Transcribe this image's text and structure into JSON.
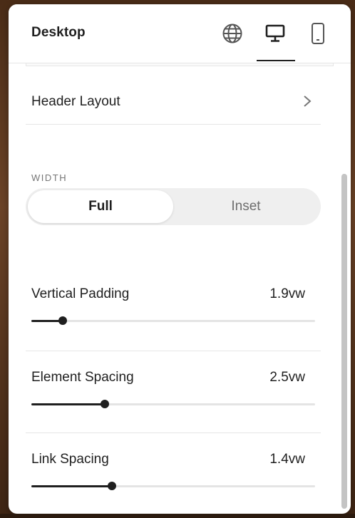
{
  "header": {
    "title": "Desktop",
    "icons": [
      "globe-icon",
      "desktop-icon",
      "mobile-icon"
    ],
    "active_view": "desktop"
  },
  "header_layout": {
    "label": "Header Layout"
  },
  "width": {
    "label": "WIDTH",
    "options": [
      "Full",
      "Inset"
    ],
    "selected": "Full"
  },
  "sliders": [
    {
      "label": "Vertical Padding",
      "value": "1.9vw",
      "fraction": 0.11
    },
    {
      "label": "Element Spacing",
      "value": "2.5vw",
      "fraction": 0.26
    },
    {
      "label": "Link Spacing",
      "value": "1.4vw",
      "fraction": 0.285
    }
  ],
  "colors": {
    "accent": "#1f1f1f",
    "muted": "#767676",
    "track": "#e4e4e4",
    "segment_bg": "#efefef"
  }
}
